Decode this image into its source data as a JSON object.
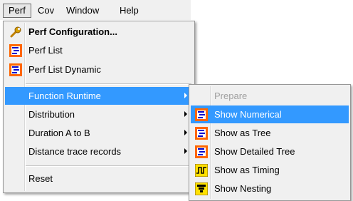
{
  "menubar": {
    "items": [
      {
        "label": "Perf",
        "mnemonic": "P",
        "active": true
      },
      {
        "label": "Cov",
        "mnemonic": "C"
      },
      {
        "label": "Window",
        "mnemonic": "W"
      },
      {
        "label": "Help",
        "mnemonic": "H"
      }
    ]
  },
  "perf_menu": {
    "items": [
      {
        "label": "Perf Configuration...",
        "icon": "wrench-icon",
        "bold": true
      },
      {
        "label": "Perf List",
        "icon": "list-icon"
      },
      {
        "label": "Perf List Dynamic",
        "icon": "list-icon"
      },
      {
        "label": "Function Runtime",
        "submenu": true,
        "highlighted": true
      },
      {
        "label": "Distribution",
        "submenu": true
      },
      {
        "label": "Duration A to B",
        "submenu": true
      },
      {
        "label": "Distance trace records",
        "submenu": true
      },
      {
        "label": "Reset"
      }
    ]
  },
  "function_runtime_submenu": {
    "items": [
      {
        "label": "Prepare",
        "disabled": true
      },
      {
        "label": "Show Numerical",
        "icon": "list-icon",
        "highlighted": true
      },
      {
        "label": "Show as Tree",
        "icon": "list-icon"
      },
      {
        "label": "Show Detailed Tree",
        "icon": "list-icon"
      },
      {
        "label": "Show as Timing",
        "icon": "timing-icon"
      },
      {
        "label": "Show Nesting",
        "icon": "nesting-icon"
      }
    ]
  },
  "colors": {
    "highlight": "#3399ff",
    "menu_bg": "#f0f0f0",
    "list_icon_bar": "#ff6600",
    "list_icon_lines": "#0000cc"
  }
}
